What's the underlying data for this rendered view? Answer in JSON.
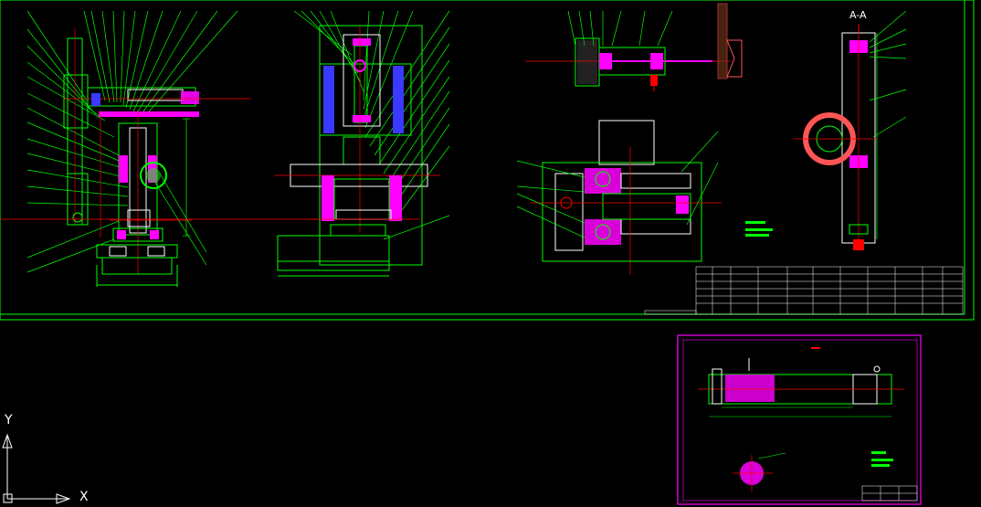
{
  "view": {
    "background": "#000000",
    "colors": {
      "green": "#00ff00",
      "white": "#ffffff",
      "red": "#ff0000",
      "magenta": "#ff00ff",
      "cyan": "#00ffff",
      "blue": "#3a3aff",
      "yellow": "#ffff00"
    }
  },
  "section_label": "A-A",
  "ucs": {
    "x_label": "X",
    "y_label": "Y"
  }
}
